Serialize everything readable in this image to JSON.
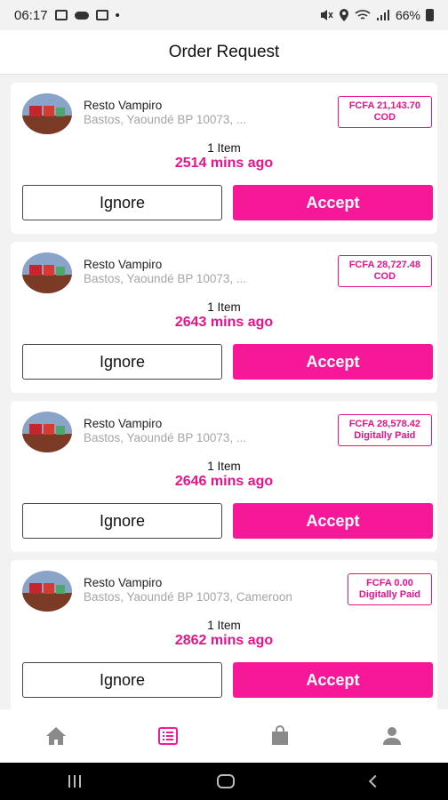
{
  "status_bar": {
    "time": "06:17",
    "battery": "66%",
    "extra": "•"
  },
  "header": {
    "title": "Order Request"
  },
  "orders": [
    {
      "restaurant": "Resto Vampiro",
      "address": "Bastos, Yaoundé BP 10073, ...",
      "price": "FCFA 21,143.70",
      "payment": "COD",
      "items": "1 Item",
      "time_ago": "2514 mins ago",
      "ignore_label": "Ignore",
      "accept_label": "Accept"
    },
    {
      "restaurant": "Resto Vampiro",
      "address": "Bastos, Yaoundé BP 10073, ...",
      "price": "FCFA 28,727.48",
      "payment": "COD",
      "items": "1 Item",
      "time_ago": "2643 mins ago",
      "ignore_label": "Ignore",
      "accept_label": "Accept"
    },
    {
      "restaurant": "Resto Vampiro",
      "address": "Bastos, Yaoundé BP 10073, ...",
      "price": "FCFA 28,578.42",
      "payment": "Digitally Paid",
      "items": "1 Item",
      "time_ago": "2646 mins ago",
      "ignore_label": "Ignore",
      "accept_label": "Accept"
    },
    {
      "restaurant": "Resto Vampiro",
      "address": "Bastos, Yaoundé BP 10073, Cameroon",
      "price": "FCFA 0.00",
      "payment": "Digitally Paid",
      "items": "1 Item",
      "time_ago": "2862 mins ago",
      "ignore_label": "Ignore",
      "accept_label": "Accept"
    }
  ],
  "bottom_nav": {
    "items": [
      {
        "icon": "home-icon",
        "active": false
      },
      {
        "icon": "orders-list-icon",
        "active": true
      },
      {
        "icon": "shopping-bag-icon",
        "active": false
      },
      {
        "icon": "profile-icon",
        "active": false
      }
    ]
  },
  "colors": {
    "accent": "#f7189a",
    "inactive_icon": "#8a8a8a"
  }
}
